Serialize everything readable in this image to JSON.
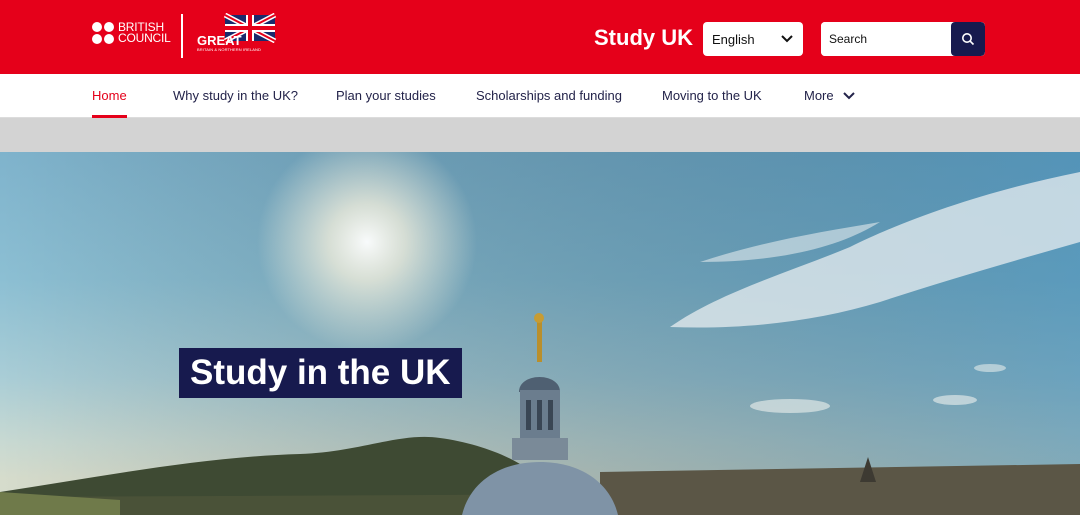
{
  "header": {
    "brand_logo_text": [
      "BRITISH",
      "COUNCIL"
    ],
    "great_logo_text": "GREAT",
    "great_logo_subtext": "BRITAIN & NORTHERN IRELAND",
    "site_title": "Study UK",
    "language": {
      "selected": "English"
    },
    "search": {
      "placeholder": "Search"
    }
  },
  "nav": {
    "items": [
      {
        "label": "Home",
        "active": true
      },
      {
        "label": "Why study in the UK?"
      },
      {
        "label": "Plan your studies"
      },
      {
        "label": "Scholarships and funding"
      },
      {
        "label": "Moving to the UK"
      },
      {
        "label": "More"
      }
    ]
  },
  "hero": {
    "title": "Study in the UK"
  },
  "colors": {
    "brand_red": "#e5001a",
    "navy": "#171a4e",
    "band_grey": "#d3d3d3"
  },
  "icons": {
    "lang_chevron": "chevron-down-icon",
    "search": "search-icon",
    "more_chevron": "chevron-down-icon"
  }
}
